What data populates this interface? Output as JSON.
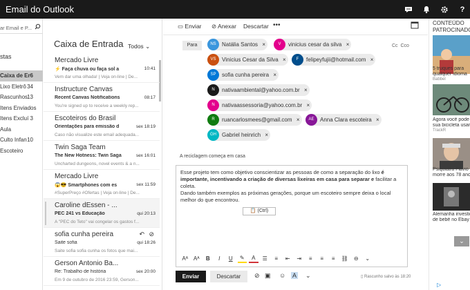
{
  "app": {
    "title": "Email do Outlook"
  },
  "topbar": {
    "icons": [
      "skype-icon",
      "bell-icon",
      "gear-icon",
      "help-icon"
    ]
  },
  "search": {
    "placeholder": "ar Email e P..."
  },
  "nav": {
    "header": "stas",
    "items": [
      {
        "label": "Caixa de Er",
        "count": "6",
        "active": true
      },
      {
        "label": "Lixo Eletrô",
        "count": "34",
        "active": false
      },
      {
        "label": "Rascunhos",
        "count": "13",
        "active": false
      },
      {
        "label": "Itens Enviados",
        "count": "",
        "active": false
      },
      {
        "label": "Itens Excluí",
        "count": "3",
        "active": false
      },
      {
        "label": "Aula",
        "count": "",
        "active": false
      },
      {
        "label": "Culto Infan",
        "count": "10",
        "active": false
      },
      {
        "label": "Escoteiro",
        "count": "",
        "active": false
      }
    ]
  },
  "list": {
    "title": "Caixa de Entrada",
    "filter": "Todos",
    "messages": [
      {
        "from": "Mercado Livre",
        "subject": "⚡ Faça chuva ou faça sol a",
        "time": "10:41",
        "preview": "Vem dar uma olhada! | Veja on-line | De..."
      },
      {
        "from": "Instructure Canvas",
        "subject": "Recent Canvas Notifications",
        "time": "08:17",
        "preview": "You're signed up to receive a weekly rep..."
      },
      {
        "from": "Escoteiros do Brasil",
        "subject": "Orientações para emissão d",
        "time": "sex 18:19",
        "preview": "Caso não visualize este email adequada..."
      },
      {
        "from": "Twin Saga Team",
        "subject": "The New Hotness: Twin Saga",
        "time": "sex 16:01",
        "preview": "Uncharted dungeons, novel events & a n..."
      },
      {
        "from": "Mercado Livre",
        "subject": "😱😎 Smartphones com es",
        "time": "sex 11:59",
        "preview": "#SuperPreço #Ofertas | Veja on-line | De..."
      },
      {
        "from": "Caroline dEssen - ...",
        "subject": "PEC 241 vs Educação",
        "time": "qui 20:13",
        "preview": "A \"PEC do Teto\" vai congelar os gastos f..."
      },
      {
        "from": "sofia cunha pereira",
        "subject": "Saite sofia",
        "time": "qui 18:26",
        "preview": "Saite sofia sofia cunha os fotos que mai..."
      },
      {
        "from": "Gerson Antonio Ba...",
        "subject": "Re: Trabalho de história",
        "time": "sex 20:00",
        "preview": "Em 9 de outubro de 2016 23:59, Gerson..."
      }
    ]
  },
  "toolbar": {
    "send": "Enviar",
    "attach": "Anexar",
    "discard": "Descartar",
    "more": "•••"
  },
  "compose": {
    "to_label": "Para",
    "cc": "Cc",
    "bcc": "Cco",
    "recipients": [
      {
        "initials": "NS",
        "name": "Natália Santos",
        "color": "#3a96dd"
      },
      {
        "initials": "V",
        "name": "vinicius cesar da silva",
        "color": "#e3008c"
      },
      {
        "initials": "VS",
        "name": "Vinicius Cesar da Silva",
        "color": "#ca5010"
      },
      {
        "initials": "F",
        "name": "felipeyfujii@hotmail.com",
        "color": "#004e8c"
      },
      {
        "initials": "SP",
        "name": "sofia cunha pereira",
        "color": "#0078d7"
      },
      {
        "initials": "N",
        "name": "nativaambiental@yahoo.com.br",
        "color": "#1a1a1a"
      },
      {
        "initials": "N",
        "name": "nativaassessoria@yahoo.com.br",
        "color": "#e3008c"
      },
      {
        "initials": "R",
        "name": "ruancarlosmees@gmail.com",
        "color": "#107c10"
      },
      {
        "initials": "AE",
        "name": "Anna Clara escoteira",
        "color": "#881798"
      },
      {
        "initials": "GH",
        "name": "Gabriel heinrich",
        "color": "#00b7c3"
      }
    ],
    "subject": "A reciclagem começa em casa",
    "body_1": "Esse projeto tem como objetivo conscientizar as pessoas de como a separação do lixo ",
    "body_2": "é importante, incentivando a criação de diversas lixeiras em casa para separar e",
    "body_3": " facilitar a coleta.",
    "body_4": "Dando também exemplos as próximas gerações, porque um escoteiro sempre deixa o local melhor do que encontrou.",
    "paste_hint": "(Ctrl)",
    "send_button": "Enviar",
    "discard_button": "Descartar",
    "draft_status": "Rascunho salvo às 18:20"
  },
  "ads": {
    "header": "CONTEÚDO PATROCINADO",
    "items": [
      {
        "text1": "5 truques para",
        "text2": "qualquer idioma",
        "source": "Babbel"
      },
      {
        "text1": "Agora você pode",
        "text2": "sua bicicleta usand",
        "source": "TrackR"
      },
      {
        "text1": "Psiquiatra Flávio G",
        "text2": "morre aos 78 anos",
        "source": ""
      },
      {
        "text1": "Alemanha investig",
        "text2": "de bebê no Ebay",
        "source": ""
      }
    ]
  }
}
